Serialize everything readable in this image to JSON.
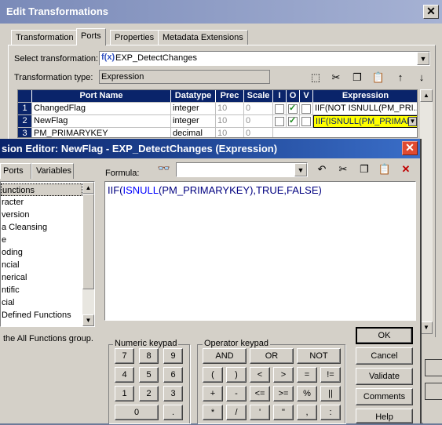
{
  "outer": {
    "title": "Edit Transformations",
    "tabs": [
      "Transformation",
      "Ports",
      "Properties",
      "Metadata Extensions"
    ],
    "select_label": "Select transformation:",
    "select_value": "EXP_DetectChanges",
    "type_label": "Transformation type:",
    "type_value": "Expression",
    "columns": [
      "Port Name",
      "Datatype",
      "Prec",
      "Scale",
      "I",
      "O",
      "V",
      "Expression"
    ],
    "rows": [
      {
        "num": "1",
        "name": "ChangedFlag",
        "datatype": "integer",
        "prec": "10",
        "scale": "0",
        "i": false,
        "o": true,
        "v": false,
        "expr": "IIF(NOT ISNULL(PM_PRI..."
      },
      {
        "num": "2",
        "name": "NewFlag",
        "datatype": "integer",
        "prec": "10",
        "scale": "0",
        "i": false,
        "o": true,
        "v": false,
        "expr": "IIF(ISNULL(PM_PRIMARY..."
      },
      {
        "num": "3",
        "name": "PM_PRIMARYKEY",
        "datatype": "decimal",
        "prec": "10",
        "scale": "0",
        "i": false,
        "o": false,
        "v": false,
        "expr": ""
      }
    ],
    "highlight_color": "#ffff00"
  },
  "editor": {
    "title": "sion Editor: NewFlag - EXP_DetectChanges (Expression)",
    "tabs": [
      "Ports",
      "Variables"
    ],
    "formula_label": "Formula:",
    "formula_text_fn": "IIF(",
    "formula_text_fn2": "ISNULL",
    "formula_text_rest": "(PM_PRIMARYKEY),TRUE,FALSE)",
    "function_groups": [
      "unctions",
      "racter",
      "version",
      "a Cleansing",
      "e",
      "oding",
      "ncial",
      "nerical",
      "ntific",
      "cial",
      "Defined Functions"
    ],
    "hint": "the All Functions group.",
    "numeric_label": "Numeric keypad",
    "numeric_keys": [
      "7",
      "8",
      "9",
      "4",
      "5",
      "6",
      "1",
      "2",
      "3",
      "0",
      "."
    ],
    "operator_label": "Operator keypad",
    "operator_keys": [
      "AND",
      "OR",
      "NOT",
      "(",
      ")",
      "<",
      ">",
      "=",
      "!=",
      "+",
      "-",
      "<=",
      ">=",
      "%",
      "||",
      "*",
      "/",
      "'",
      "\"",
      ",",
      ":"
    ],
    "buttons": [
      "OK",
      "Cancel",
      "Validate",
      "Comments",
      "Help"
    ],
    "accent": "#0a246a"
  }
}
